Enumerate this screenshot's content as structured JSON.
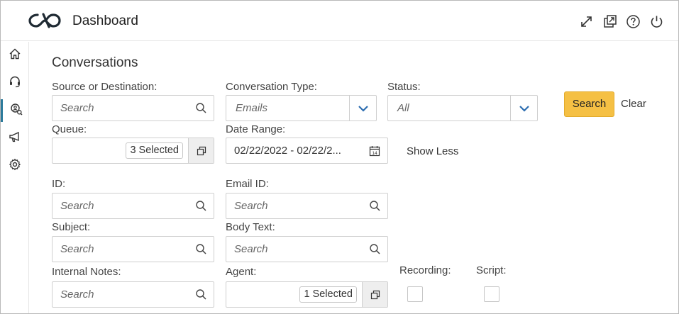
{
  "header": {
    "title": "Dashboard"
  },
  "page": {
    "title": "Conversations"
  },
  "fields": {
    "source": {
      "label": "Source or Destination:",
      "placeholder": "Search"
    },
    "conv_type": {
      "label": "Conversation Type:",
      "placeholder": "Emails"
    },
    "status": {
      "label": "Status:",
      "placeholder": "All"
    },
    "queue": {
      "label": "Queue:",
      "selected": "3 Selected"
    },
    "date_range": {
      "label": "Date Range:",
      "value": "02/22/2022 - 02/22/2..."
    },
    "id": {
      "label": "ID:",
      "placeholder": "Search"
    },
    "email_id": {
      "label": "Email ID:",
      "placeholder": "Search"
    },
    "subject": {
      "label": "Subject:",
      "placeholder": "Search"
    },
    "body_text": {
      "label": "Body Text:",
      "placeholder": "Search"
    },
    "internal_notes": {
      "label": "Internal Notes:",
      "placeholder": "Search"
    },
    "agent": {
      "label": "Agent:",
      "selected": "1 Selected"
    },
    "recording": {
      "label": "Recording:"
    },
    "script": {
      "label": "Script:"
    }
  },
  "actions": {
    "search": "Search",
    "clear": "Clear",
    "show_less": "Show Less",
    "calendar_day": "14"
  },
  "colors": {
    "accent": "#2b7a9b",
    "search_button": "#f5c044",
    "chevron": "#2b6cb0"
  }
}
